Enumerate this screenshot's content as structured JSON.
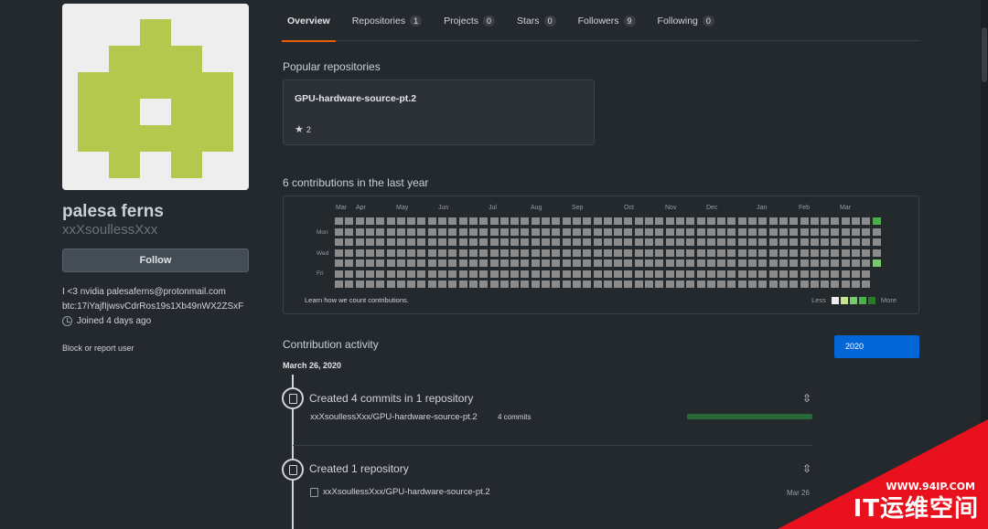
{
  "tabs": [
    {
      "label": "Overview",
      "count": null
    },
    {
      "label": "Repositories",
      "count": "1"
    },
    {
      "label": "Projects",
      "count": "0"
    },
    {
      "label": "Stars",
      "count": "0"
    },
    {
      "label": "Followers",
      "count": "9"
    },
    {
      "label": "Following",
      "count": "0"
    }
  ],
  "profile": {
    "name": "palesa ferns",
    "login": "xxXsoullessXxx",
    "follow_label": "Follow",
    "bio_line1": "I <3 nvidia palesaferns@protonmail.com",
    "bio_line2": "btc:17iYajfIjwsvCdrRos19s1Xb49nWX2ZSxF",
    "joined": "Joined 4 days ago",
    "block_label": "Block or report user"
  },
  "popular": {
    "title": "Popular repositories",
    "repo_name": "GPU-hardware-source-pt.2",
    "stars": "2"
  },
  "contributions": {
    "title": "6 contributions in the last year",
    "months": [
      "Mar",
      "Apr",
      "May",
      "Jun",
      "Jul",
      "Aug",
      "Sep",
      "Oct",
      "Nov",
      "Dec",
      "Jan",
      "Feb",
      "Mar"
    ],
    "days": [
      "Mon",
      "Wed",
      "Fri"
    ],
    "footer": "Learn how we count contributions.",
    "legend_less": "Less",
    "legend_more": "More",
    "legend_colors": [
      "#eeeeee",
      "#c6e48b",
      "#7bc96f",
      "#4cae4c",
      "#2d7a2d"
    ]
  },
  "activity": {
    "title": "Contribution activity",
    "year": "2020",
    "date": "March 26, 2020",
    "item1_title": "Created 4 commits in 1 repository",
    "item1_repo": "xxXsoullessXxx/GPU-hardware-source-pt.2",
    "item1_commits": "4 commits",
    "item2_title": "Created 1 repository",
    "item2_repo": "xxXsoullessXxx/GPU-hardware-source-pt.2",
    "item2_date": "Mar 26"
  },
  "watermark": {
    "url": "WWW.94IP.COM",
    "text": "IT运维空间"
  }
}
